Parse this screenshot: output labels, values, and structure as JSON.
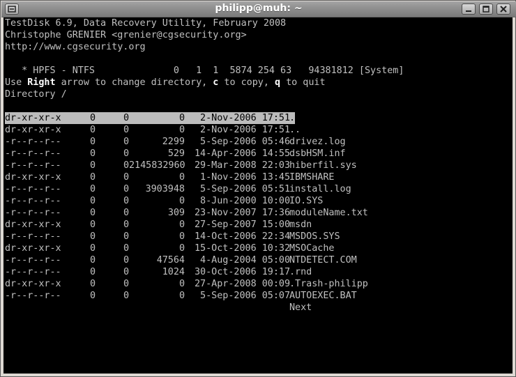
{
  "window": {
    "title": "philipp@muh: ~"
  },
  "header": {
    "line1": "TestDisk 6.9, Data Recovery Utility, February 2008",
    "line2": "Christophe GRENIER <grenier@cgsecurity.org>",
    "line3": "http://www.cgsecurity.org"
  },
  "partition": {
    "line": "   * HPFS - NTFS              0   1  1  5874 254 63   94381812 [System]"
  },
  "help": {
    "prefix": "Use ",
    "key_right": "Right",
    "mid1": " arrow to change directory, ",
    "key_copy": "c",
    "mid2": " to copy, ",
    "key_quit": "q",
    "suffix": " to quit"
  },
  "directory": {
    "label": "Directory /"
  },
  "entries": [
    {
      "perm": "dr-xr-xr-x",
      "uid": "0",
      "gid": "0",
      "size": "0",
      "date": " 2-Nov-2006 17:51",
      "name": ".",
      "selected": true
    },
    {
      "perm": "dr-xr-xr-x",
      "uid": "0",
      "gid": "0",
      "size": "0",
      "date": " 2-Nov-2006 17:51",
      "name": ".."
    },
    {
      "perm": "-r--r--r--",
      "uid": "0",
      "gid": "0",
      "size": "2299",
      "date": " 5-Sep-2006 05:46",
      "name": "drivez.log"
    },
    {
      "perm": "-r--r--r--",
      "uid": "0",
      "gid": "0",
      "size": "529",
      "date": "14-Apr-2006 14:55",
      "name": "dsbHSM.inf"
    },
    {
      "perm": "-r--r--r--",
      "uid": "0",
      "gid": "0",
      "size": "2145832960",
      "date": "29-Mar-2008 22:03",
      "name": "hiberfil.sys"
    },
    {
      "perm": "dr-xr-xr-x",
      "uid": "0",
      "gid": "0",
      "size": "0",
      "date": " 1-Nov-2006 13:45",
      "name": "IBMSHARE"
    },
    {
      "perm": "-r--r--r--",
      "uid": "0",
      "gid": "0",
      "size": "3903948",
      "date": " 5-Sep-2006 05:51",
      "name": "install.log"
    },
    {
      "perm": "-r--r--r--",
      "uid": "0",
      "gid": "0",
      "size": "0",
      "date": " 8-Jun-2000 10:00",
      "name": "IO.SYS"
    },
    {
      "perm": "-r--r--r--",
      "uid": "0",
      "gid": "0",
      "size": "309",
      "date": "23-Nov-2007 17:36",
      "name": "moduleName.txt"
    },
    {
      "perm": "dr-xr-xr-x",
      "uid": "0",
      "gid": "0",
      "size": "0",
      "date": "27-Sep-2007 15:00",
      "name": "msdn"
    },
    {
      "perm": "-r--r--r--",
      "uid": "0",
      "gid": "0",
      "size": "0",
      "date": "14-Oct-2006 22:34",
      "name": "MSDOS.SYS"
    },
    {
      "perm": "dr-xr-xr-x",
      "uid": "0",
      "gid": "0",
      "size": "0",
      "date": "15-Oct-2006 10:32",
      "name": "MSOCache"
    },
    {
      "perm": "-r--r--r--",
      "uid": "0",
      "gid": "0",
      "size": "47564",
      "date": " 4-Aug-2004 05:00",
      "name": "NTDETECT.COM"
    },
    {
      "perm": "-r--r--r--",
      "uid": "0",
      "gid": "0",
      "size": "1024",
      "date": "30-Oct-2006 19:17",
      "name": ".rnd"
    },
    {
      "perm": "dr-xr-xr-x",
      "uid": "0",
      "gid": "0",
      "size": "0",
      "date": "27-Apr-2008 00:09",
      "name": ".Trash-philipp"
    },
    {
      "perm": "-r--r--r--",
      "uid": "0",
      "gid": "0",
      "size": "0",
      "date": " 5-Sep-2006 05:07",
      "name": "AUTOEXEC.BAT"
    }
  ],
  "footer": {
    "next": "Next"
  },
  "icons": {
    "menu": "window-menu-icon",
    "minimize": "minimize-icon",
    "maximize": "maximize-icon",
    "close": "close-icon"
  },
  "colors": {
    "terminal_bg": "#000000",
    "terminal_fg": "#c0c0c0",
    "selection_bg": "#bcbcbc",
    "titlebar": "#8d8d8d"
  }
}
